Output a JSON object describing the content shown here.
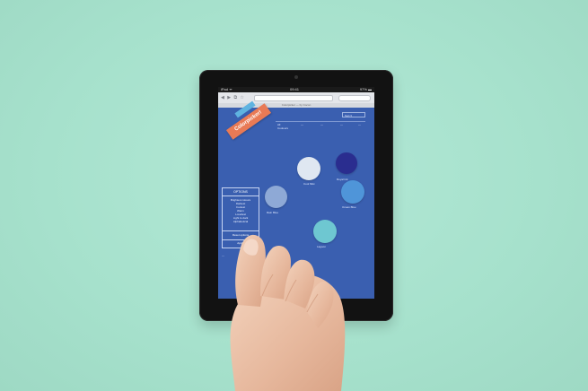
{
  "device": {
    "status_left": "iPad ᯤ",
    "status_time": "09:41",
    "status_right": "97% ▬"
  },
  "browser": {
    "nav_icons": "◀ ▶ ⧉ ☆",
    "page_title": "Colorpicker — by Cocon"
  },
  "app": {
    "ribbon_label": "Colorpicker!",
    "sort_label": "Sort ▾",
    "column_headers": [
      "All",
      "Coolours",
      "—",
      "—",
      "—",
      "—"
    ],
    "swatches": [
      {
        "color": "#dfe7f1",
        "label": "Cool Mist"
      },
      {
        "color": "#2a2d8f",
        "label": "Royal Ink"
      },
      {
        "color": "#8ea9d6",
        "label": "Rain Blue"
      },
      {
        "color": "#4f95d9",
        "label": "Ocean Blue"
      },
      {
        "color": "#6ec7d1",
        "label": "Lagoon"
      }
    ],
    "options": {
      "title": "OPTIONS",
      "items": [
        "Brightest colours",
        "Darkest",
        "Coolest",
        "Warm",
        "Loveliest",
        "Light to dark",
        "Alphabetical"
      ],
      "reset": "Reset options",
      "apply": "Apply"
    },
    "side_note": "—"
  },
  "colors": {
    "background": "#a9e3cf",
    "screen": "#3a5fb0",
    "ribbon": "#e97a55",
    "bezel": "#121212"
  }
}
